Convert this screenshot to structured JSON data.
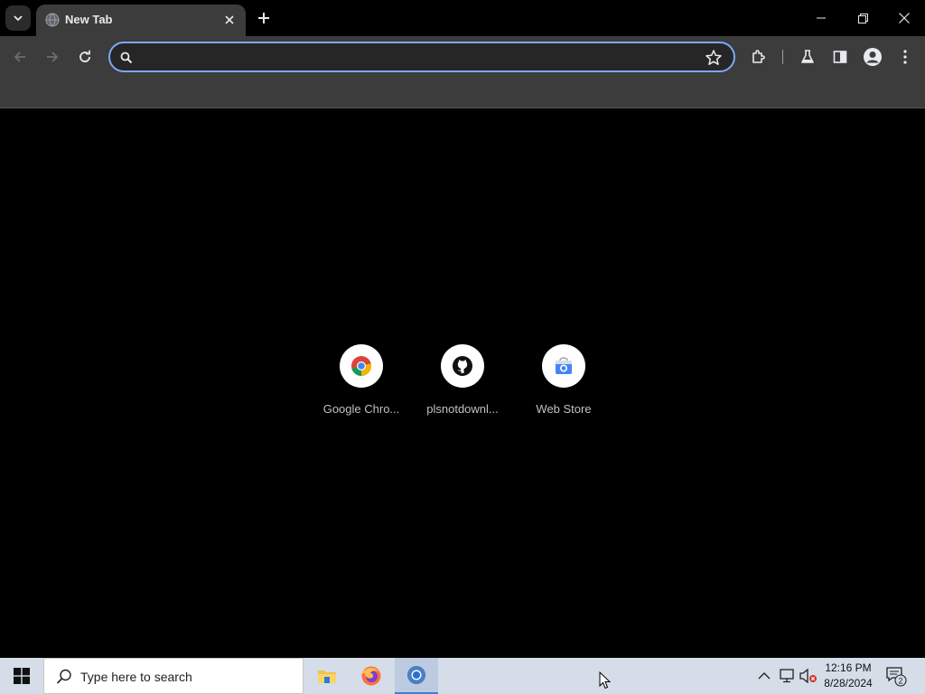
{
  "browser": {
    "tab": {
      "title": "New Tab"
    },
    "omnibox": {
      "value": "",
      "placeholder": ""
    }
  },
  "new_tab_page": {
    "shortcuts": [
      {
        "label": "Google Chro...",
        "icon": "chrome-icon"
      },
      {
        "label": "plsnotdownl...",
        "icon": "github-icon"
      },
      {
        "label": "Web Store",
        "icon": "web-store-icon"
      }
    ]
  },
  "taskbar": {
    "search_placeholder": "Type here to search",
    "clock": {
      "time": "12:16 PM",
      "date": "8/28/2024"
    },
    "notification_count": "2"
  },
  "colors": {
    "accent": "#7ca8f7",
    "toolbar_bg": "#3c3c3c",
    "page_bg": "#000000",
    "taskbar_bg": "#d4dde8"
  }
}
